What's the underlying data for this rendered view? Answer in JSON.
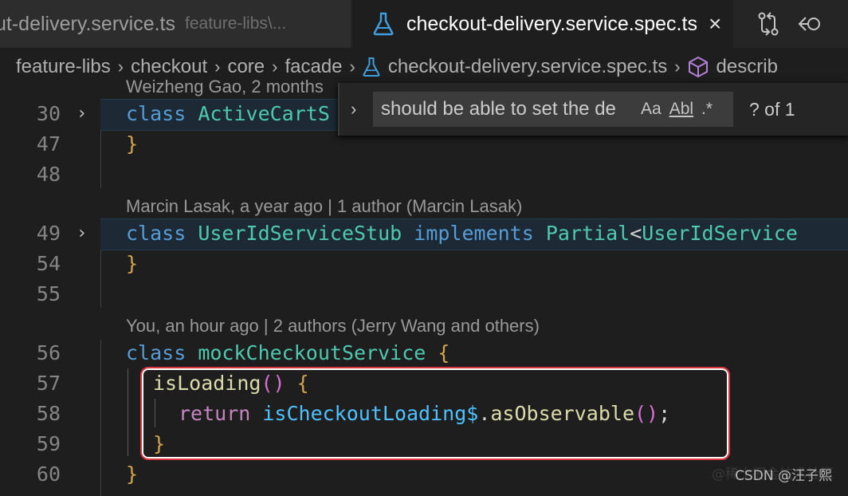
{
  "tabs": {
    "inactive": {
      "name": "ut-delivery.service.ts",
      "path": "feature-libs\\..."
    },
    "active": {
      "name": "checkout-delivery.service.spec.ts",
      "close": "×"
    }
  },
  "breadcrumb": {
    "segments": [
      "feature-libs",
      "checkout",
      "core",
      "facade"
    ],
    "file": "checkout-delivery.service.spec.ts",
    "symbol": "describ"
  },
  "find": {
    "query": "should be able to set the de",
    "match_case": "Aa",
    "whole_word": "Abl",
    "regex": ".*",
    "count": "? of 1"
  },
  "codelens": {
    "first": "Weizheng Gao, 2 months",
    "second": "Marcin Lasak, a year ago | 1 author (Marcin Lasak)",
    "third": "You, an hour ago | 2 authors (Jerry Wang and others)"
  },
  "lines": [
    {
      "num": "30",
      "kw": "class",
      "name": "ActiveCartS"
    },
    {
      "num": "47",
      "brace": "}"
    },
    {
      "num": "48"
    },
    {
      "num": "49",
      "kw": "class",
      "name": "UserIdServiceStub",
      "impl": "implements",
      "partial": "Partial",
      "lt": "<",
      "generic": "UserIdService"
    },
    {
      "num": "54",
      "brace": "}"
    },
    {
      "num": "55"
    },
    {
      "num": "56",
      "kw": "class",
      "name": "mockCheckoutService",
      "brace": "{"
    },
    {
      "num": "57",
      "method": "isLoading",
      "parens": "()",
      "brace": "{"
    },
    {
      "num": "58",
      "ret": "return",
      "var": "isCheckoutLoading$",
      "dot": ".",
      "call": "asObservable",
      "parens": "()",
      "semi": ";"
    },
    {
      "num": "59",
      "brace": "}"
    },
    {
      "num": "60",
      "brace": "}"
    }
  ],
  "watermark": "CSDN @汪子熙",
  "watermark_bg": "@稀土掘金技术社区"
}
